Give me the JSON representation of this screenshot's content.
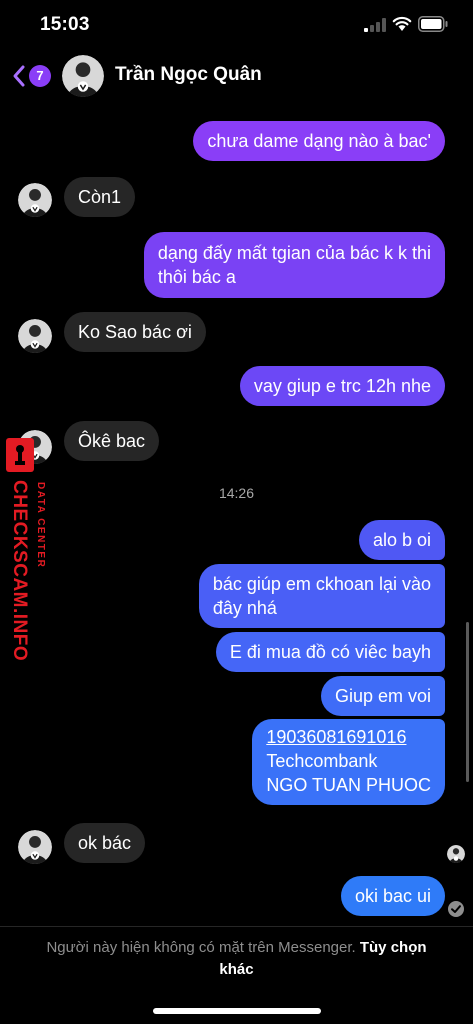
{
  "status_bar": {
    "time": "15:03"
  },
  "header": {
    "unread_count": "7",
    "contact_name": "Trần Ngọc Quân"
  },
  "messages": [
    {
      "text": "chưa dame dạng nào à bac'"
    },
    {
      "text": "Còn1"
    },
    {
      "line1": "dạng đấy mất tgian của bác k k thi",
      "line2": "thôi bác a"
    },
    {
      "text": "Ko Sao bác ơi"
    },
    {
      "text": "vay giup e trc 12h nhe"
    },
    {
      "text": "Ôkê bac"
    },
    {
      "text": "alo b oi"
    },
    {
      "line1": "bác giúp em ckhoan lại vào",
      "line2": "đây nhá"
    },
    {
      "text": "E đi mua đồ có viêc bayh"
    },
    {
      "text": "Giup em voi"
    },
    {
      "line1": "19036081691016",
      "line2": "Techcombank",
      "line3": "NGO TUAN PHUOC"
    },
    {
      "text": "ok bác"
    },
    {
      "text": "oki bac ui"
    }
  ],
  "timestamp": "14:26",
  "watermark": {
    "main": "CHECKSCAM.INFO",
    "sub": "DATA CENTER"
  },
  "footer": {
    "notice": "Người này hiện không có mặt trên Messenger.",
    "action": "Tùy chọn khác"
  },
  "colors": {
    "incoming_bubble": "#262626",
    "badge": "#8a3ef7",
    "watermark": "#e31b23"
  }
}
